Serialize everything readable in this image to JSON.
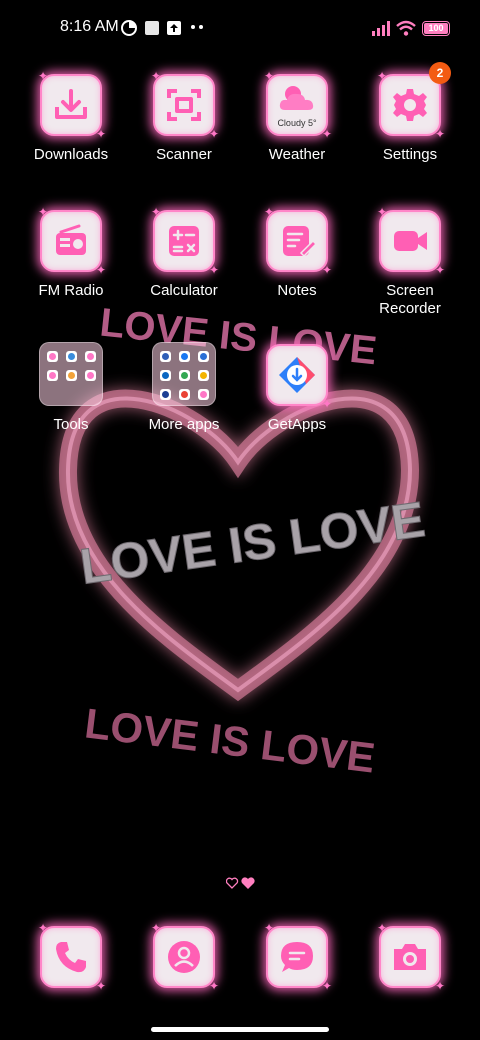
{
  "status_bar": {
    "time": "8:16 AM",
    "battery": "100",
    "icons": [
      "data-saver-icon",
      "notification-square-icon",
      "upload-icon",
      "more-dots-icon",
      "signal-icon",
      "wifi-icon",
      "battery-icon"
    ]
  },
  "wallpaper": {
    "text_top": "LOVE IS LOVE",
    "text_middle": "LOVE IS LOVE",
    "text_bottom": "LOVE IS LOVE"
  },
  "apps": {
    "downloads": "Downloads",
    "scanner": "Scanner",
    "weather": "Weather",
    "weather_text": "Cloudy 5°",
    "settings": "Settings",
    "settings_badge": "2",
    "fm_radio": "FM Radio",
    "calculator": "Calculator",
    "notes": "Notes",
    "screen_recorder_line1": "Screen",
    "screen_recorder_line2": "Recorder",
    "tools": "Tools",
    "more_apps": "More apps",
    "getapps": "GetApps"
  },
  "dock": [
    "phone-icon",
    "contacts-icon",
    "messages-icon",
    "camera-icon"
  ],
  "pages": {
    "count": 2,
    "current": 2
  },
  "colors": {
    "accent": "#ff6fbf",
    "tile": "#f1e9ee",
    "badge": "#f35b12",
    "background": "#000000"
  }
}
